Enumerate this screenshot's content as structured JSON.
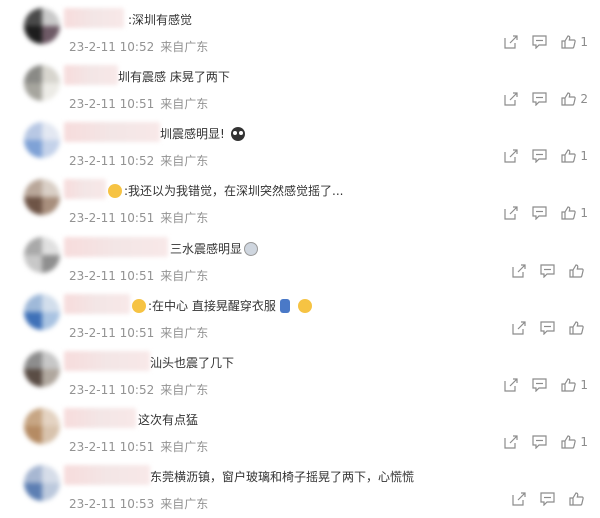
{
  "comments": [
    {
      "text": ":深圳有感觉",
      "time": "23-2-11 10:52",
      "location": "来自广东",
      "likes": "1"
    },
    {
      "text": "圳有震感 床晃了两下",
      "time": "23-2-11 10:51",
      "location": "来自广东",
      "likes": "2"
    },
    {
      "text": "圳震感明显!",
      "time": "23-2-11 10:52",
      "location": "来自广东",
      "likes": "1",
      "emoji": "dark-face-icon"
    },
    {
      "text": ":我还以为我错觉，在深圳突然感觉摇了...",
      "time": "23-2-11 10:51",
      "location": "来自广东",
      "likes": "1",
      "pre_emoji": "cool-face-icon"
    },
    {
      "text": "三水震感明显",
      "time": "23-2-11 10:51",
      "location": "来自广东",
      "likes": "",
      "emoji": "shocked-face-icon"
    },
    {
      "text": ":在中心 直接晃醒穿衣服",
      "time": "23-2-11 10:51",
      "location": "来自广东",
      "likes": "",
      "pre_emoji": "hand-icon",
      "emoji": "tired-face-icon"
    },
    {
      "text": "汕头也震了几下",
      "time": "23-2-11 10:52",
      "location": "来自广东",
      "likes": "1"
    },
    {
      "text": "这次有点猛",
      "time": "23-2-11 10:51",
      "location": "来自广东",
      "likes": "1"
    },
    {
      "text": "东莞横沥镇，窗户玻璃和椅子摇晃了两下，心慌慌",
      "time": "23-2-11 10:53",
      "location": "来自广东",
      "likes": ""
    }
  ]
}
